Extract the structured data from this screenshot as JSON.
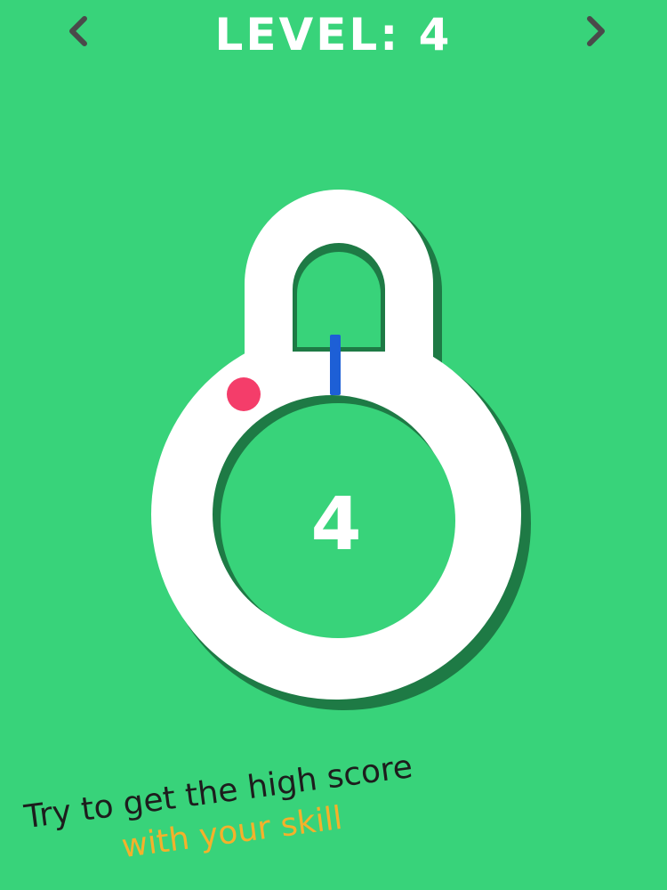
{
  "header": {
    "level_label": "LEVEL:",
    "level_value": "4",
    "prev_icon": "chevron-left-icon",
    "next_icon": "chevron-right-icon"
  },
  "game": {
    "lock_number": "4"
  },
  "tagline": {
    "line1": "Try to get the high score",
    "line2": "with your skill"
  },
  "colors": {
    "background": "#38d37a",
    "lock": "#ffffff",
    "shadow": "#1e7a45",
    "target_dot": "#f43d6a",
    "needle": "#1d5fd6",
    "tagline_primary": "#1d1d1d",
    "tagline_accent": "#f4b12b",
    "nav_arrow": "#4a4a4a"
  }
}
